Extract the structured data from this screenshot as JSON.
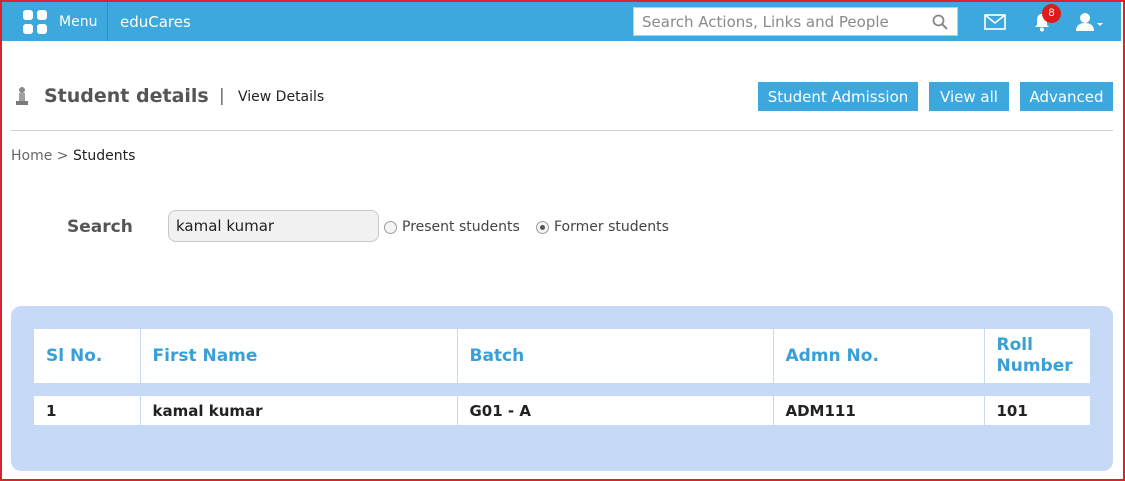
{
  "topbar": {
    "menu_label": "Menu",
    "brand": "eduCares",
    "search_placeholder": "Search Actions, Links and People",
    "notification_count": "8",
    "icons": [
      "grid-icon",
      "search-icon",
      "mail-icon",
      "bell-icon",
      "user-icon"
    ]
  },
  "header": {
    "title": "Student details",
    "separator": "|",
    "subtitle": "View Details",
    "buttons": {
      "admission": "Student Admission",
      "view_all": "View all",
      "advanced": "Advanced"
    }
  },
  "breadcrumb": {
    "home": "Home",
    "separator": ">",
    "current": "Students"
  },
  "search": {
    "label": "Search",
    "value": "kamal kumar",
    "options": {
      "present": "Present students",
      "former": "Former students"
    },
    "selected": "former"
  },
  "table": {
    "columns": [
      "Sl No.",
      "First Name",
      "Batch",
      "Admn No.",
      "Roll Number"
    ],
    "rows": [
      [
        "1",
        "kamal kumar",
        "G01 - A",
        "ADM111",
        "101"
      ]
    ]
  },
  "colors": {
    "accent": "#3da8dd",
    "panel": "#c6daf8",
    "header_text": "#3a9fd6",
    "frame": "#d9232d",
    "badge": "#e01b1b"
  }
}
